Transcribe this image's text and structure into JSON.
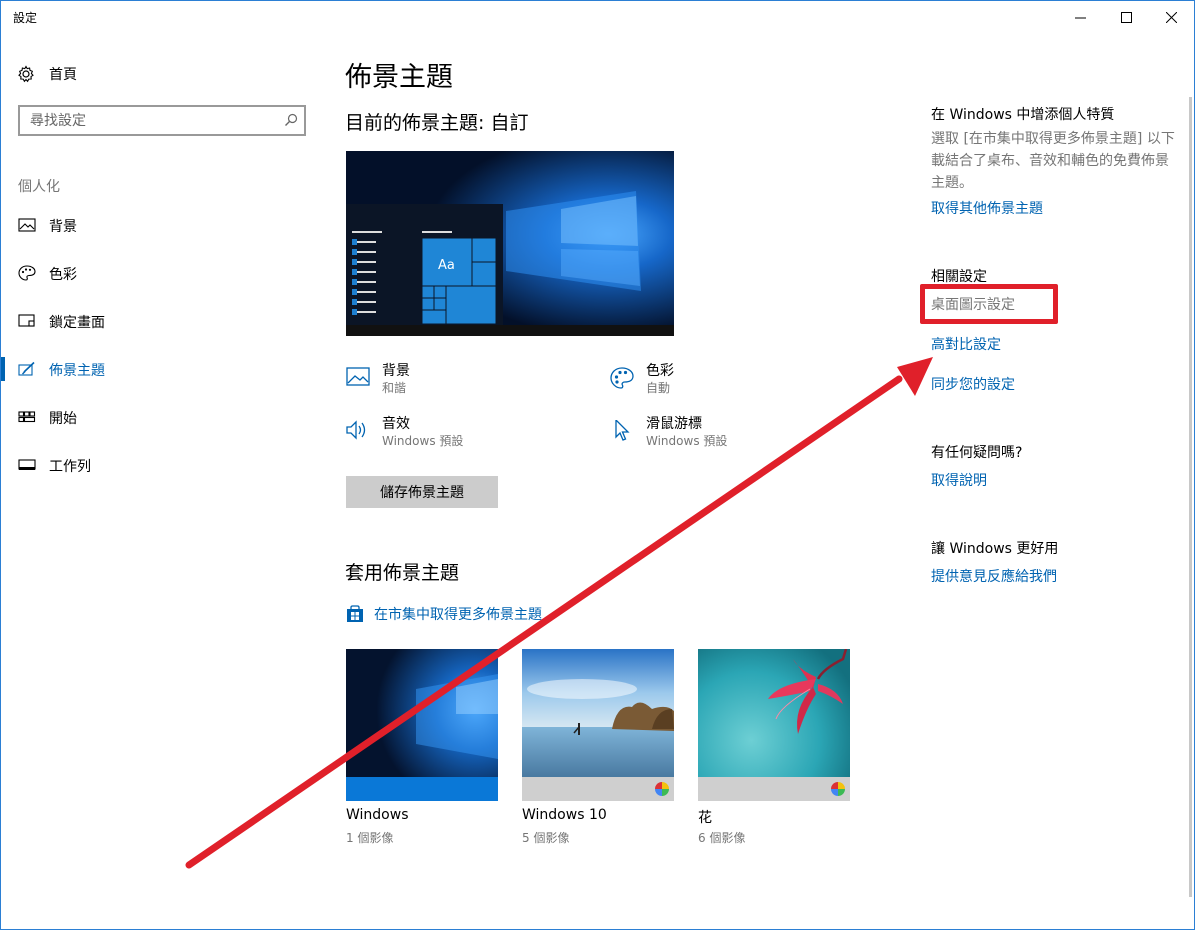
{
  "window": {
    "title": "設定"
  },
  "sidebar": {
    "home_label": "首頁",
    "search_placeholder": "尋找設定",
    "section_label": "個人化",
    "items": [
      {
        "label": "背景",
        "icon": "picture-icon"
      },
      {
        "label": "色彩",
        "icon": "palette-icon"
      },
      {
        "label": "鎖定畫面",
        "icon": "lock-screen-icon"
      },
      {
        "label": "佈景主題",
        "icon": "themes-brush-icon",
        "active": true
      },
      {
        "label": "開始",
        "icon": "start-grid-icon"
      },
      {
        "label": "工作列",
        "icon": "taskbar-icon"
      }
    ]
  },
  "main": {
    "page_title": "佈景主題",
    "current_theme": "目前的佈景主題: 自訂",
    "preview_tile_text": "Aa",
    "attributes": {
      "background": {
        "title": "背景",
        "value": "和諧"
      },
      "color": {
        "title": "色彩",
        "value": "自動"
      },
      "sounds": {
        "title": "音效",
        "value": "Windows 預設"
      },
      "cursor": {
        "title": "滑鼠游標",
        "value": "Windows 預設"
      }
    },
    "save_button": "儲存佈景主題",
    "apply_title": "套用佈景主題",
    "store_link": "在市集中取得更多佈景主題",
    "themes": [
      {
        "name": "Windows",
        "count": "1 個影像"
      },
      {
        "name": "Windows 10",
        "count": "5 個影像"
      },
      {
        "name": "花",
        "count": "6 個影像"
      }
    ]
  },
  "right_pane": {
    "personalize_title": "在 Windows 中增添個人特質",
    "personalize_text": "選取 [在市集中取得更多佈景主題] 以下載結合了桌布、音效和輔色的免費佈景主題。",
    "get_more_link": "取得其他佈景主題",
    "related_title": "相關設定",
    "desktop_icons": "桌面圖示設定",
    "high_contrast": "高對比設定",
    "sync_settings": "同步您的設定",
    "question_title": "有任何疑問嗎?",
    "get_help": "取得說明",
    "better_title": "讓 Windows 更好用",
    "feedback": "提供意見反應給我們"
  },
  "colors": {
    "accent": "#0063b1",
    "annotation": "#e0202a",
    "window_border": "#2b7fd4"
  }
}
